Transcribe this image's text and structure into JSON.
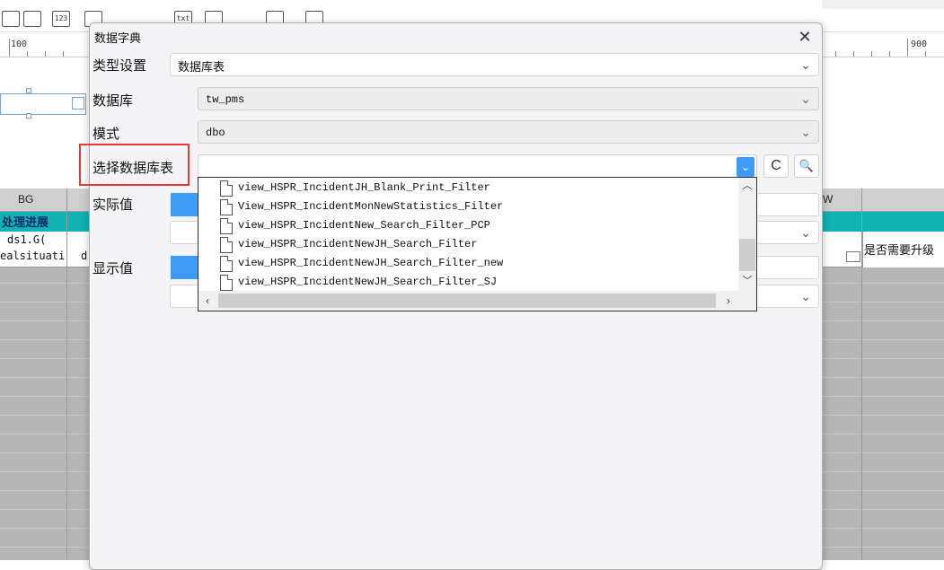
{
  "background": {
    "ruler": {
      "left_label": "100",
      "right_label": "900"
    },
    "grid": {
      "header_bg": "BG",
      "header_w": "W",
      "teal_cell": "处理进展",
      "cell_line1": "ds1.G(",
      "cell_line2": "ealsituati",
      "cell_line3": "d",
      "upgrade_label": "是否需要升级"
    },
    "toolbar_icons": [
      "grid-icon",
      "calendar-icon",
      "number-icon",
      "list-icon",
      "radio-icon",
      "checkbox-icon",
      "text-icon",
      "dots-icon",
      "checkbox-group-icon",
      "tree-icon",
      "table-icon"
    ],
    "toolbar_icon_text": {
      "number": "123",
      "text": "txt"
    }
  },
  "dialog": {
    "title": "数据字典",
    "close_symbol": "✕",
    "type_setting": {
      "label": "类型设置",
      "value": "数据库表"
    },
    "database": {
      "label": "数据库",
      "value": "tw_pms"
    },
    "schema": {
      "label": "模式",
      "value": "dbo"
    },
    "select_table": {
      "label": "选择数据库表",
      "value": ""
    },
    "actual_value": {
      "label": "实际值"
    },
    "display_value": {
      "label": "显示值"
    },
    "refresh_symbol": "C",
    "preview_symbol": "🔍",
    "dropdown": {
      "items": [
        "view_HSPR_IncidentJH_Blank_Print_Filter",
        "View_HSPR_IncidentMonNewStatistics_Filter",
        "view_HSPR_IncidentNew_Search_Filter_PCP",
        "view_HSPR_IncidentNewJH_Search_Filter",
        "view_HSPR_IncidentNewJH_Search_Filter_new",
        "view_HSPR_IncidentNewJH_Search_Filter_SJ"
      ]
    }
  },
  "colors": {
    "accent": "#3d9bf8",
    "highlight": "#e53935",
    "teal": "#12b3b3"
  }
}
